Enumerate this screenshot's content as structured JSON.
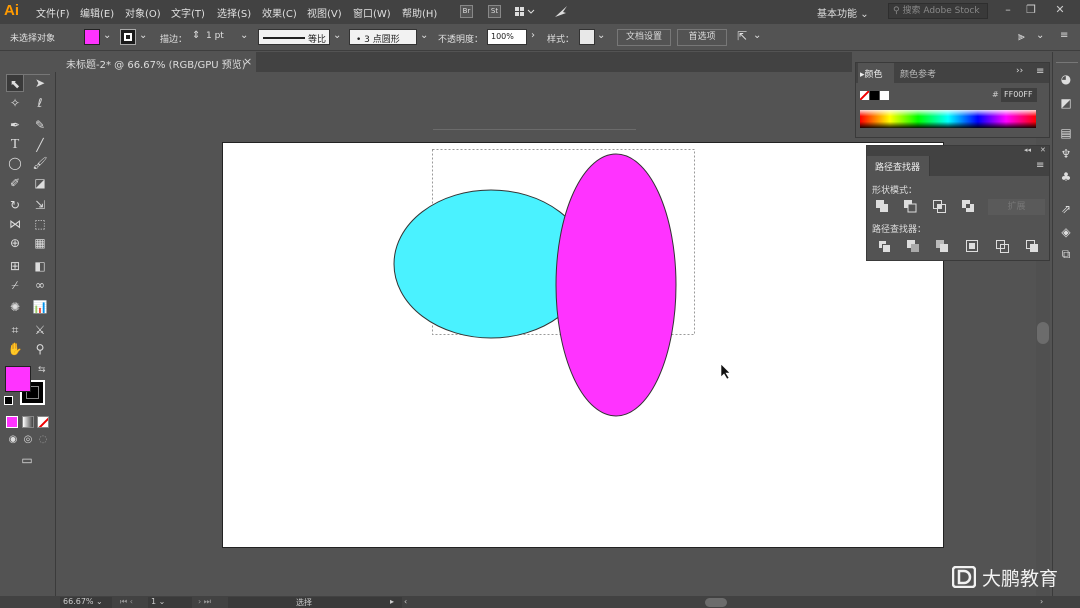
{
  "app": {
    "logo": "Ai"
  },
  "menu": [
    "文件(F)",
    "编辑(E)",
    "对象(O)",
    "文字(T)",
    "选择(S)",
    "效果(C)",
    "视图(V)",
    "窗口(W)",
    "帮助(H)"
  ],
  "menubar_icons": [
    "Br",
    "St"
  ],
  "workspace": "基本功能",
  "stock_search": {
    "placeholder": "搜索 Adobe Stock"
  },
  "control": {
    "selection": "未选择对象",
    "stroke_label": "描边：",
    "stroke_value": "1 pt",
    "stroke_profile": "等比",
    "brush": "3 点圆形",
    "opacity_label": "不透明度：",
    "opacity_value": "100%",
    "style_label": "样式：",
    "doc_setup": "文档设置",
    "preferences": "首选项"
  },
  "document": {
    "tab": "未标题-2* @ 66.67% (RGB/GPU 预览)",
    "close": "×"
  },
  "colors": {
    "fill": "#ff33ff",
    "ellipse_cyan": "#4af2ff",
    "ellipse_magenta": "#ff33ff"
  },
  "color_panel": {
    "tab1": "颜色",
    "tab2": "颜色参考",
    "hex_prefix": "#",
    "hex_value": "FF00FF"
  },
  "pathfinder": {
    "title": "路径查找器",
    "shape_modes": "形状模式：",
    "expand": "扩展",
    "pathfinders": "路径查找器："
  },
  "status": {
    "zoom": "66.67%",
    "page": "1",
    "mode": "选择"
  },
  "watermark": "大鹏教育"
}
